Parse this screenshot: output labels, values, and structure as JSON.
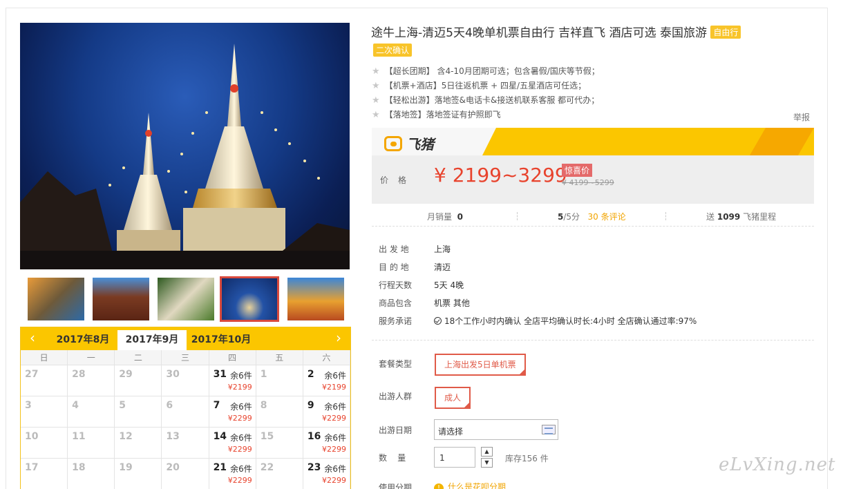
{
  "product": {
    "title": "途牛上海-清迈5天4晚单机票自由行 吉祥直飞 酒店可选 泰国旅游",
    "tag_freetour": "自由行",
    "tag_confirm": "二次确认",
    "features": [
      "【超长团期】 含4-10月团期可选；包含暑假/国庆等节假；",
      "【机票+酒店】5日往返机票 + 四星/五星酒店可任选；",
      "【轻松出游】落地签&电话卡&接送机联系客服 都可代办；",
      "【落地签】落地签证有护照即飞"
    ],
    "report": "举报"
  },
  "brand": {
    "name": "飞猪",
    "accent": "#fbc600"
  },
  "price": {
    "label": "价格",
    "value": "¥ 2199~3299",
    "tag": "惊喜价",
    "original": "¥ 4199~5299"
  },
  "stats": {
    "sales_label": "月销量",
    "sales_value": "0",
    "rating_value": "5",
    "rating_suffix": "/5分",
    "reviews": "30 条评论",
    "mileage_prefix": "送",
    "mileage_value": "1099",
    "mileage_suffix": "飞猪里程"
  },
  "info": [
    {
      "key": "出 发 地",
      "value": "上海"
    },
    {
      "key": "目 的 地",
      "value": "清迈"
    },
    {
      "key": "行程天数",
      "value": "5天 4晚"
    },
    {
      "key": "商品包含",
      "value": "机票  其他"
    },
    {
      "key": "服务承诺",
      "value": "18个工作小时内确认    全店平均确认时长:4小时    全店确认通过率:97%"
    }
  ],
  "options": {
    "package_label": "套餐类型",
    "package_value": "上海出发5日单机票",
    "traveler_label": "出游人群",
    "traveler_value": "成人",
    "date_label": "出游日期",
    "date_placeholder": "请选择",
    "qty_label": "数    量",
    "qty_value": "1",
    "stock": "库存156 件",
    "installment_label": "使用分期",
    "installment_link": "什么是花呗分期"
  },
  "calendar": {
    "months": [
      "2017年8月",
      "2017年9月",
      "2017年10月"
    ],
    "active_month": "2017年9月",
    "weekdays": [
      "日",
      "一",
      "二",
      "三",
      "四",
      "五",
      "六"
    ],
    "weeks": [
      [
        {
          "d": "27"
        },
        {
          "d": "28"
        },
        {
          "d": "29"
        },
        {
          "d": "30"
        },
        {
          "d": "31",
          "stock": "余6件",
          "price": "¥2199"
        },
        {
          "d": "1"
        },
        {
          "d": "2",
          "stock": "余6件",
          "price": "¥2199"
        }
      ],
      [
        {
          "d": "3"
        },
        {
          "d": "4"
        },
        {
          "d": "5"
        },
        {
          "d": "6"
        },
        {
          "d": "7",
          "stock": "余6件",
          "price": "¥2299"
        },
        {
          "d": "8"
        },
        {
          "d": "9",
          "stock": "余6件",
          "price": "¥2299"
        }
      ],
      [
        {
          "d": "10"
        },
        {
          "d": "11"
        },
        {
          "d": "12"
        },
        {
          "d": "13"
        },
        {
          "d": "14",
          "stock": "余6件",
          "price": "¥2299"
        },
        {
          "d": "15"
        },
        {
          "d": "16",
          "stock": "余6件",
          "price": "¥2299"
        }
      ],
      [
        {
          "d": "17"
        },
        {
          "d": "18"
        },
        {
          "d": "19"
        },
        {
          "d": "20"
        },
        {
          "d": "21",
          "stock": "余6件",
          "price": "¥2299"
        },
        {
          "d": "22"
        },
        {
          "d": "23",
          "stock": "余6件",
          "price": "¥2299"
        }
      ]
    ]
  },
  "watermark": "eLvXing.net"
}
